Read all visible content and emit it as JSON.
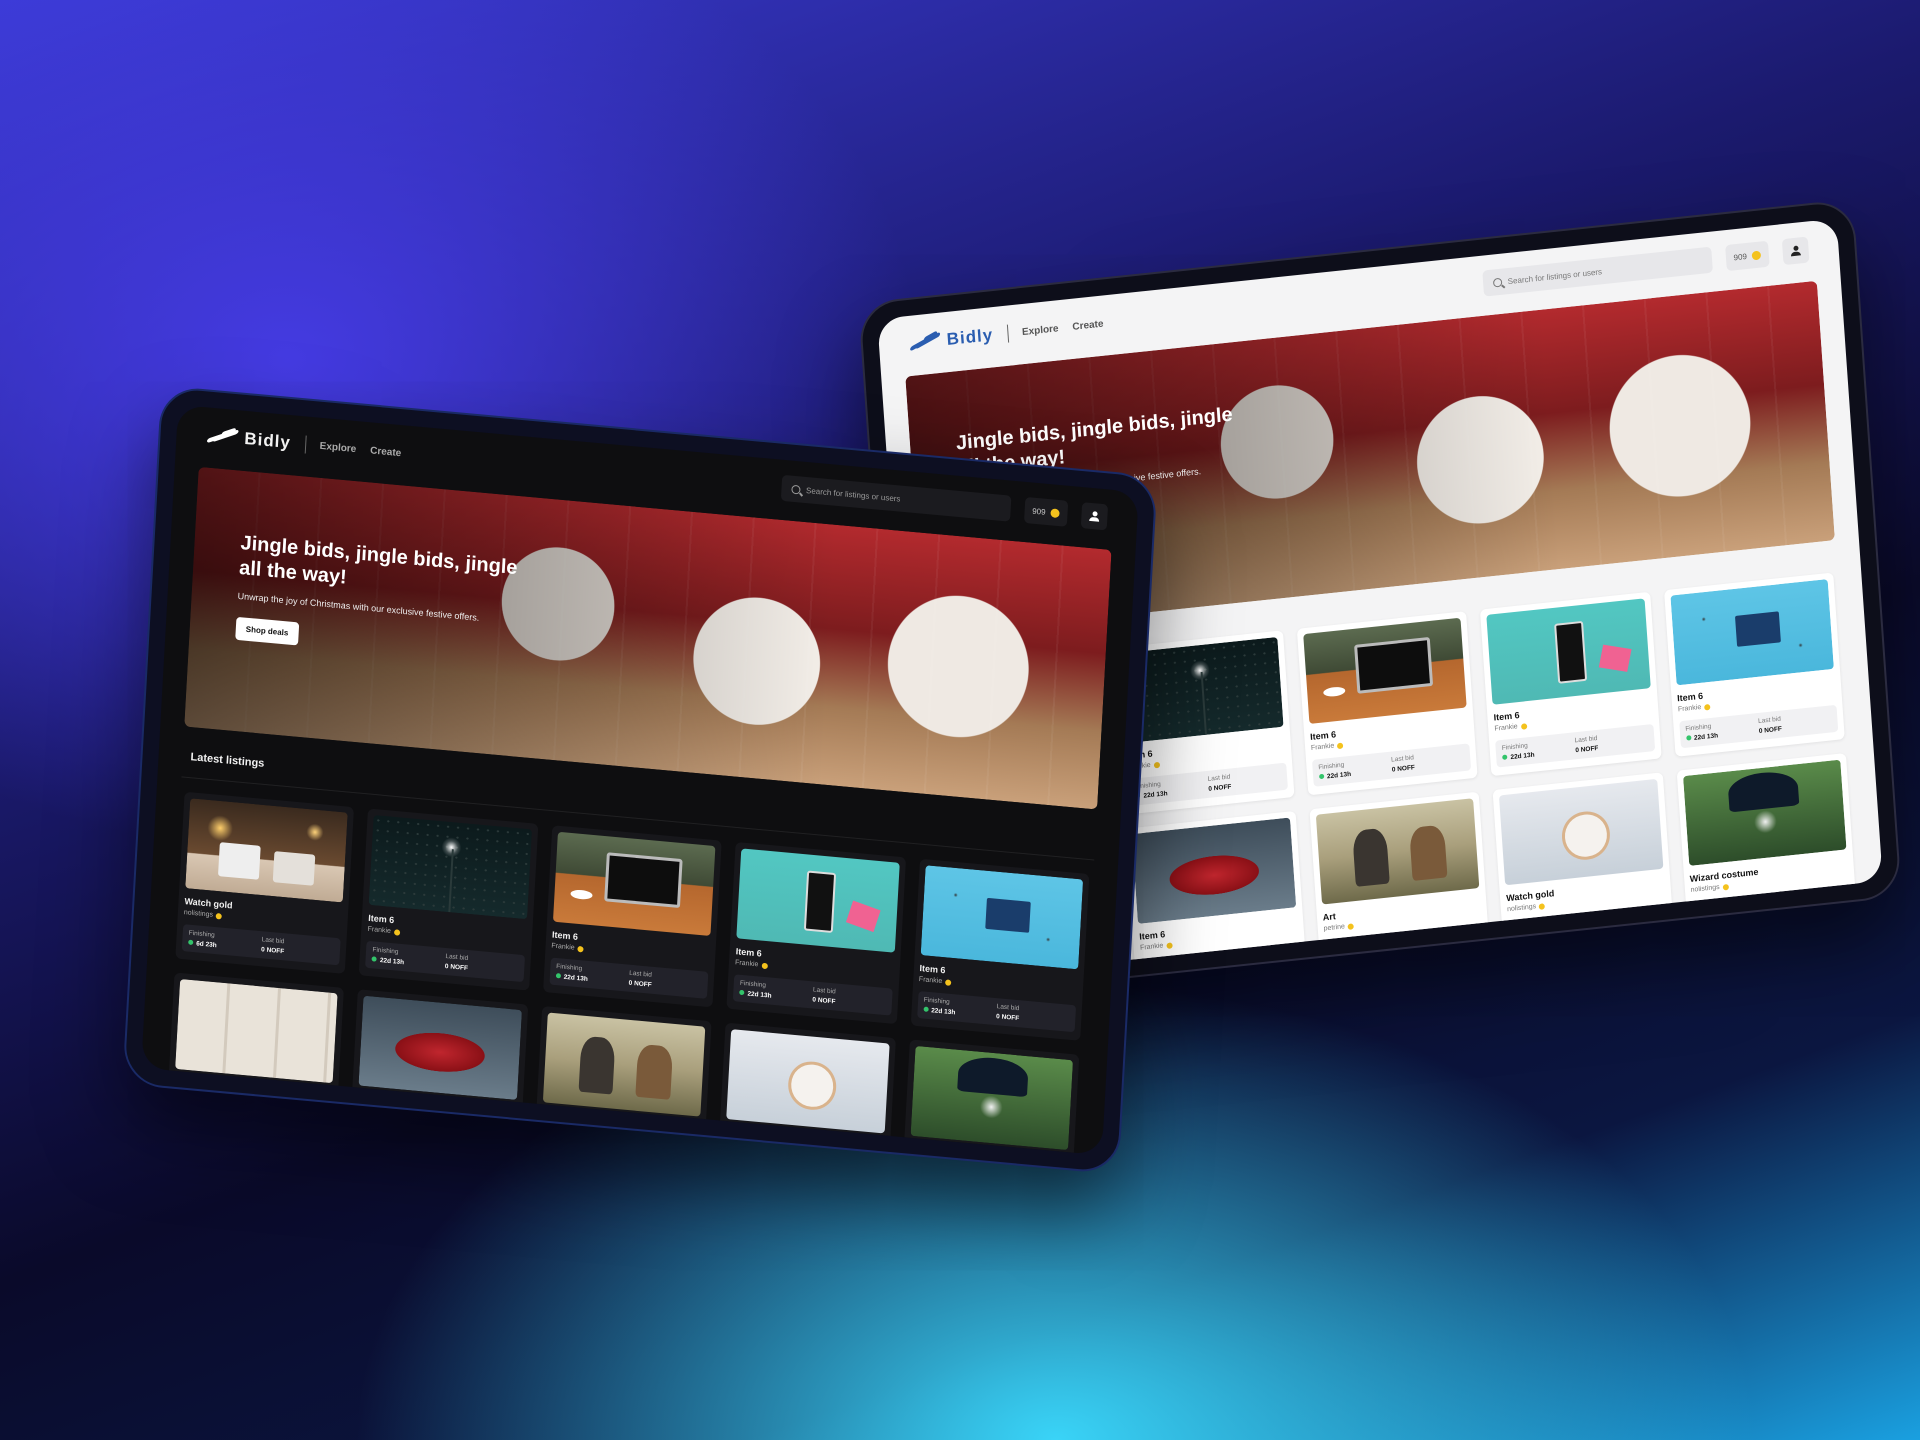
{
  "app": {
    "name": "Bidly",
    "nav": [
      "Explore",
      "Create"
    ],
    "search_placeholder": "Search for listings or users",
    "balance": "909",
    "accent": "#2a5db0",
    "coin_color": "#f4c21d"
  },
  "hero": {
    "title": "Jingle bids, jingle bids, jingle all the way!",
    "subtitle": "Unwrap the joy of Christmas with our exclusive festive offers.",
    "cta": "Shop deals"
  },
  "section_title": "Latest listings",
  "labels": {
    "finishing": "Finishing",
    "last_bid": "Last bid"
  },
  "dark_listings": [
    {
      "thumb": "mugs",
      "title": "Watch gold",
      "seller": "nolistings",
      "finishing": "6d 23h",
      "last_bid": "0 NOFF"
    },
    {
      "thumb": "sky",
      "title": "Item 6",
      "seller": "Frankie",
      "finishing": "22d 13h",
      "last_bid": "0 NOFF"
    },
    {
      "thumb": "laptop",
      "title": "Item 6",
      "seller": "Frankie",
      "finishing": "22d 13h",
      "last_bid": "0 NOFF"
    },
    {
      "thumb": "phone",
      "title": "Item 6",
      "seller": "Frankie",
      "finishing": "22d 13h",
      "last_bid": "0 NOFF"
    },
    {
      "thumb": "arduino",
      "title": "Item 6",
      "seller": "Frankie",
      "finishing": "22d 13h",
      "last_bid": "0 NOFF"
    },
    {
      "thumb": "soap",
      "title": "Item 6",
      "seller": "Frankie",
      "finishing": "",
      "last_bid": ""
    },
    {
      "thumb": "straw",
      "title": "Item 6",
      "seller": "Frankie",
      "finishing": "",
      "last_bid": ""
    },
    {
      "thumb": "art",
      "title": "Art",
      "seller": "petrine",
      "finishing": "",
      "last_bid": ""
    },
    {
      "thumb": "watch",
      "title": "Watch gold",
      "seller": "nolistings",
      "finishing": "",
      "last_bid": ""
    },
    {
      "thumb": "wizard",
      "title": "Wizard costume",
      "seller": "nolistings",
      "finishing": "",
      "last_bid": ""
    }
  ],
  "light_listings": [
    {
      "thumb": "mugs",
      "title": "",
      "seller": "",
      "finishing": "",
      "last_bid": ""
    },
    {
      "thumb": "sky",
      "title": "Item 6",
      "seller": "Frankie",
      "finishing": "22d 13h",
      "last_bid": "0 NOFF"
    },
    {
      "thumb": "laptop",
      "title": "Item 6",
      "seller": "Frankie",
      "finishing": "22d 13h",
      "last_bid": "0 NOFF"
    },
    {
      "thumb": "phone",
      "title": "Item 6",
      "seller": "Frankie",
      "finishing": "22d 13h",
      "last_bid": "0 NOFF"
    },
    {
      "thumb": "arduino",
      "title": "Item 6",
      "seller": "Frankie",
      "finishing": "22d 13h",
      "last_bid": "0 NOFF"
    },
    {
      "thumb": "soap",
      "title": "",
      "seller": "",
      "finishing": "",
      "last_bid": ""
    },
    {
      "thumb": "straw",
      "title": "Item 6",
      "seller": "Frankie",
      "finishing": "",
      "last_bid": ""
    },
    {
      "thumb": "art",
      "title": "Art",
      "seller": "petrine",
      "finishing": "",
      "last_bid": ""
    },
    {
      "thumb": "watch",
      "title": "Watch gold",
      "seller": "nolistings",
      "finishing": "",
      "last_bid": ""
    },
    {
      "thumb": "wizard",
      "title": "Wizard costume",
      "seller": "nolistings",
      "finishing": "",
      "last_bid": ""
    }
  ]
}
